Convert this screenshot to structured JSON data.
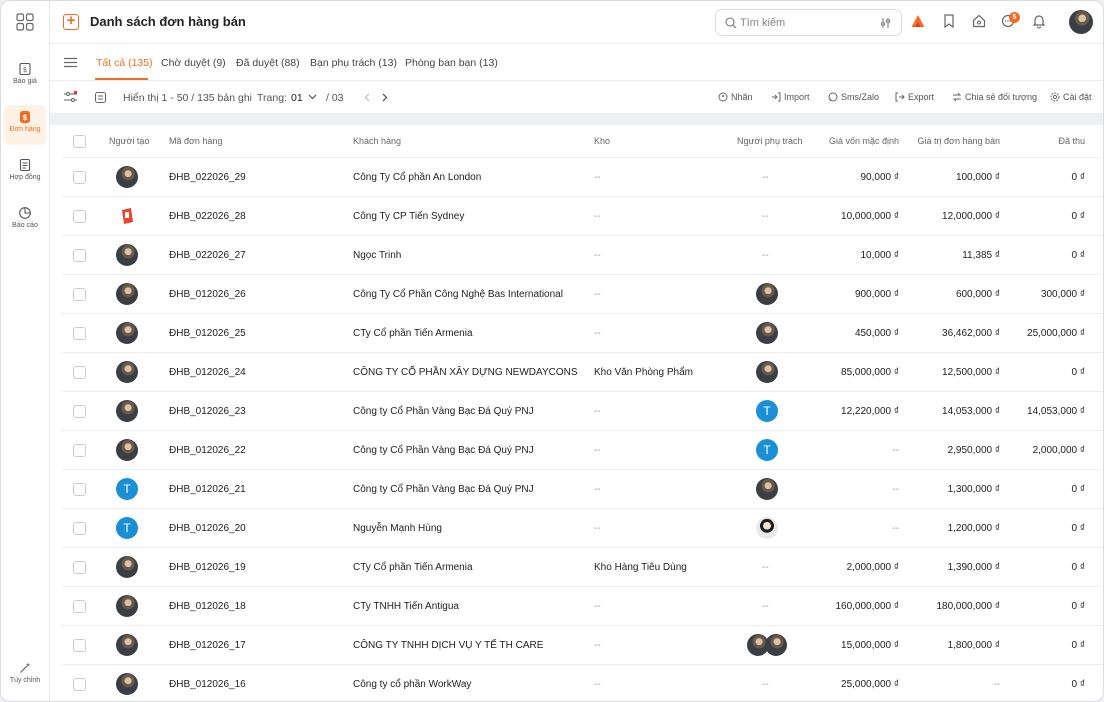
{
  "sidebar": {
    "items": [
      {
        "label": "Báo giá",
        "icon": "quote-icon"
      },
      {
        "label": "Đơn hàng",
        "icon": "order-icon",
        "active": true
      },
      {
        "label": "Hợp đồng",
        "icon": "contract-icon"
      },
      {
        "label": "Báo cáo",
        "icon": "report-icon"
      }
    ],
    "bottom": {
      "label": "Tùy chỉnh",
      "icon": "magic-wand-icon"
    }
  },
  "header": {
    "title": "Danh sách đơn hàng bán",
    "search_placeholder": "Tìm kiếm",
    "notification_count": "5"
  },
  "tabs": [
    {
      "label": "Tất cả (135)",
      "active": true
    },
    {
      "label": "Chờ duyệt (9)"
    },
    {
      "label": "Đã duyệt (88)"
    },
    {
      "label": "Bạn phụ trách (13)"
    },
    {
      "label": "Phòng ban bạn (13)"
    }
  ],
  "toolbar": {
    "showing": "Hiển thị 1 - 50 / 135 bản ghi",
    "page_label": "Trang:",
    "page_current": "01",
    "page_total": "/ 03",
    "actions": {
      "label": "Nhãn",
      "import": "Import",
      "sms": "Sms/Zalo",
      "export": "Export",
      "share": "Chia sẻ đối tượng",
      "settings": "Cài đặt"
    }
  },
  "table": {
    "headers": {
      "creator": "Người tạo",
      "code": "Mã đơn hàng",
      "customer": "Khách hàng",
      "warehouse": "Kho",
      "owner": "Người phụ trách",
      "cost": "Giá vốn mặc định",
      "value": "Giá trị đơn hàng bán",
      "paid": "Đã thu"
    },
    "rows": [
      {
        "creator": "photo",
        "code": "ĐHB_022026_29",
        "customer": "Công Ty Cổ phần An London",
        "warehouse": "--",
        "owner": "--",
        "cost": "90,000 ₫",
        "value": "100,000 ₫",
        "paid": "0 ₫"
      },
      {
        "creator": "logo",
        "code": "ĐHB_022026_28",
        "customer": "Công Ty CP Tiến Sydney",
        "warehouse": "--",
        "owner": "--",
        "cost": "10,000,000 ₫",
        "value": "12,000,000 ₫",
        "paid": "0 ₫"
      },
      {
        "creator": "photo",
        "code": "ĐHB_022026_27",
        "customer": "Ngọc Trinh",
        "warehouse": "--",
        "owner": "--",
        "cost": "10,000 ₫",
        "value": "11,385 ₫",
        "paid": "0 ₫"
      },
      {
        "creator": "photo",
        "code": "ĐHB_012026_26",
        "customer": "Công Ty Cổ Phần Công Nghệ Bas International",
        "warehouse": "--",
        "owner": "photo",
        "cost": "900,000 ₫",
        "value": "600,000 ₫",
        "paid": "300,000 ₫"
      },
      {
        "creator": "photo",
        "code": "ĐHB_012026_25",
        "customer": "CTy Cổ phần Tiến Armenia",
        "warehouse": "--",
        "owner": "photo",
        "cost": "450,000 ₫",
        "value": "36,462,000 ₫",
        "paid": "25,000,000 ₫"
      },
      {
        "creator": "photo",
        "code": "ĐHB_012026_24",
        "customer": "CÔNG TY CỔ PHẦN XÂY DỰNG NEWDAYCONS",
        "warehouse": "Kho Văn Phòng Phẩm",
        "owner": "photo",
        "cost": "85,000,000 ₫",
        "value": "12,500,000 ₫",
        "paid": "0 ₫"
      },
      {
        "creator": "photo",
        "code": "ĐHB_012026_23",
        "customer": "Công ty Cổ Phần Vàng Bạc Đá Quý PNJ",
        "warehouse": "--",
        "owner": "T",
        "cost": "12,220,000 ₫",
        "value": "14,053,000 ₫",
        "paid": "14,053,000 ₫"
      },
      {
        "creator": "photo",
        "code": "ĐHB_012026_22",
        "customer": "Công ty Cổ Phần Vàng Bạc Đá Quý PNJ",
        "warehouse": "--",
        "owner": "T",
        "cost": "--",
        "value": "2,950,000 ₫",
        "paid": "2,000,000 ₫"
      },
      {
        "creator": "T",
        "code": "ĐHB_012026_21",
        "customer": "Công ty Cổ Phần Vàng Bạc Đá Quý PNJ",
        "warehouse": "--",
        "owner": "photo",
        "cost": "--",
        "value": "1,300,000 ₫",
        "paid": "0 ₫"
      },
      {
        "creator": "T",
        "code": "ĐHB_012026_20",
        "customer": "Nguyễn Mạnh Hùng",
        "warehouse": "--",
        "owner": "photo2",
        "cost": "--",
        "value": "1,200,000 ₫",
        "paid": "0 ₫"
      },
      {
        "creator": "photo",
        "code": "ĐHB_012026_19",
        "customer": "CTy Cổ phần Tiến Armenia",
        "warehouse": "Kho Hàng Tiêu Dùng",
        "owner": "--",
        "cost": "2,000,000 ₫",
        "value": "1,390,000 ₫",
        "paid": "0 ₫"
      },
      {
        "creator": "photo",
        "code": "ĐHB_012026_18",
        "customer": "CTy TNHH Tiến Antigua",
        "warehouse": "--",
        "owner": "--",
        "cost": "160,000,000 ₫",
        "value": "180,000,000 ₫",
        "paid": "0 ₫"
      },
      {
        "creator": "photo",
        "code": "ĐHB_012026_17",
        "customer": "CÔNG TY TNHH DỊCH VỤ Y TẾ TH CARE",
        "warehouse": "--",
        "owner": "photo-pair",
        "cost": "15,000,000 ₫",
        "value": "1,800,000 ₫",
        "paid": "0 ₫"
      },
      {
        "creator": "photo",
        "code": "ĐHB_012026_16",
        "customer": "Công ty cổ phần WorkWay",
        "warehouse": "--",
        "owner": "--",
        "cost": "25,000,000 ₫",
        "value": "--",
        "paid": "0 ₫"
      }
    ]
  },
  "colors": {
    "accent": "#f26d21",
    "avatar_blue": "#1a8fd6"
  }
}
